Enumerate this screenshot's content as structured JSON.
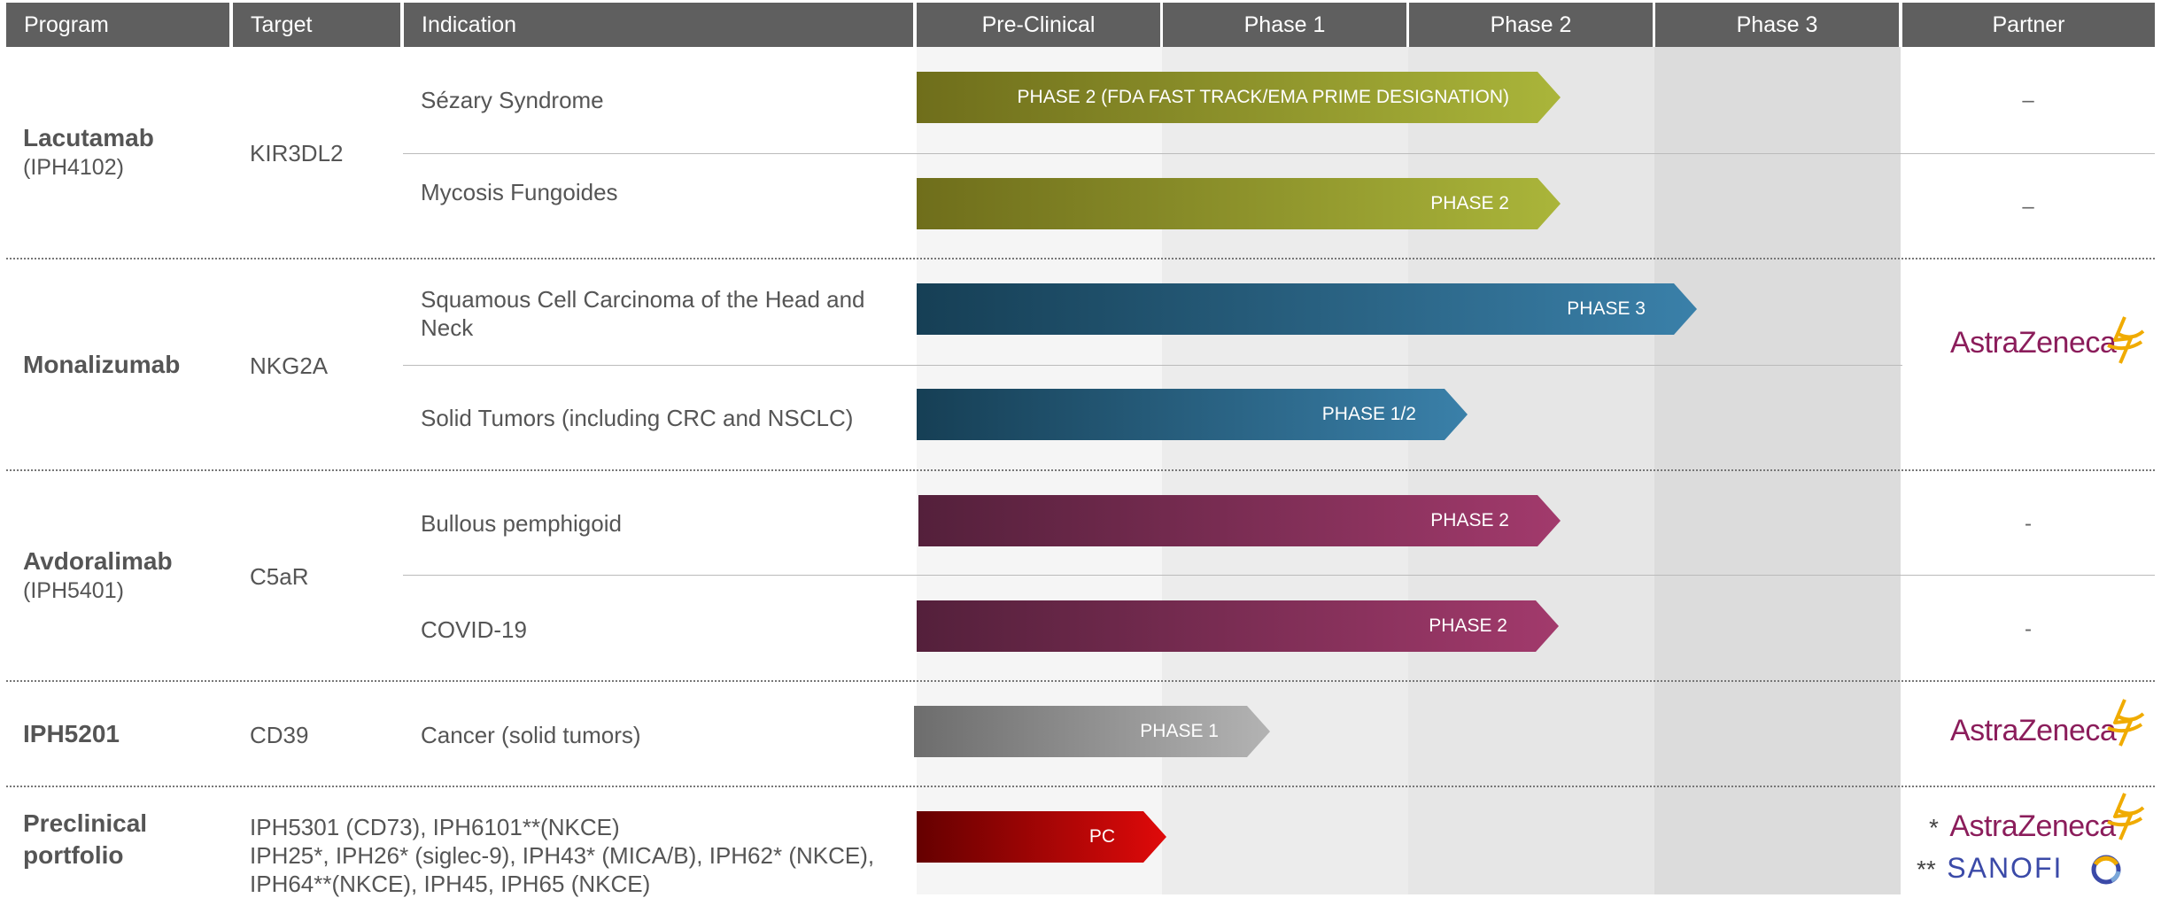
{
  "header": {
    "program": "Program",
    "target": "Target",
    "indication": "Indication",
    "preclinical": "Pre-Clinical",
    "phase1": "Phase 1",
    "phase2": "Phase 2",
    "phase3": "Phase 3",
    "partner": "Partner"
  },
  "colors": {
    "olive": "#aab53a",
    "blue": "#3a80a9",
    "plum": "#a23a6c",
    "grey": "#b3b3b3",
    "red": "#e00a0a",
    "astrazeneca": "#8b1d5b",
    "astrazeneca_symbol": "#f0ab00",
    "sanofi": "#3b4aa8"
  },
  "programs": [
    {
      "name": "Lacutamab",
      "code": "(IPH4102)",
      "target": "KIR3DL2",
      "rows": [
        {
          "indication": "Sézary Syndrome",
          "stage": "PHASE 2 (FDA FAST TRACK/EMA PRIME DESIGNATION)",
          "progress": 2.6,
          "partner": "–"
        },
        {
          "indication": "Mycosis Fungoides",
          "stage": "PHASE 2",
          "progress": 2.6,
          "partner": "–"
        }
      ]
    },
    {
      "name": "Monalizumab",
      "target": "NKG2A",
      "partner_logo": "AstraZeneca",
      "rows": [
        {
          "indication": "Squamous Cell Carcinoma of the Head and Neck",
          "stage": "PHASE 3",
          "progress": 3.2
        },
        {
          "indication": "Solid Tumors (including CRC and NSCLC)",
          "stage": "PHASE 1/2",
          "progress": 2.2
        }
      ]
    },
    {
      "name": "Avdoralimab",
      "code": "(IPH5401)",
      "target": "C5aR",
      "rows": [
        {
          "indication": "Bullous pemphigoid",
          "stage": "PHASE 2",
          "progress": 2.6,
          "partner": "-"
        },
        {
          "indication": "COVID-19",
          "stage": "PHASE 2",
          "progress": 2.6,
          "partner": "-"
        }
      ]
    },
    {
      "name": "IPH5201",
      "target": "CD39",
      "partner_logo": "AstraZeneca",
      "rows": [
        {
          "indication": "Cancer (solid tumors)",
          "stage": "PHASE 1",
          "progress": 1.45
        }
      ]
    },
    {
      "name_line1": "Preclinical",
      "name_line2": "portfolio",
      "target_lines": [
        "IPH5301 (CD73), IPH6101**(NKCE)",
        "IPH25*, IPH26* (siglec-9), IPH43* (MICA/B), IPH62* (NKCE),",
        "IPH64**(NKCE), IPH45, IPH65 (NKCE)"
      ],
      "stage": "PC",
      "progress": 1.0,
      "partner_az_prefix": "*",
      "partner_sanofi_prefix": "**",
      "partner_logo_az": "AstraZeneca",
      "partner_logo_sanofi": "SANOFI"
    }
  ]
}
